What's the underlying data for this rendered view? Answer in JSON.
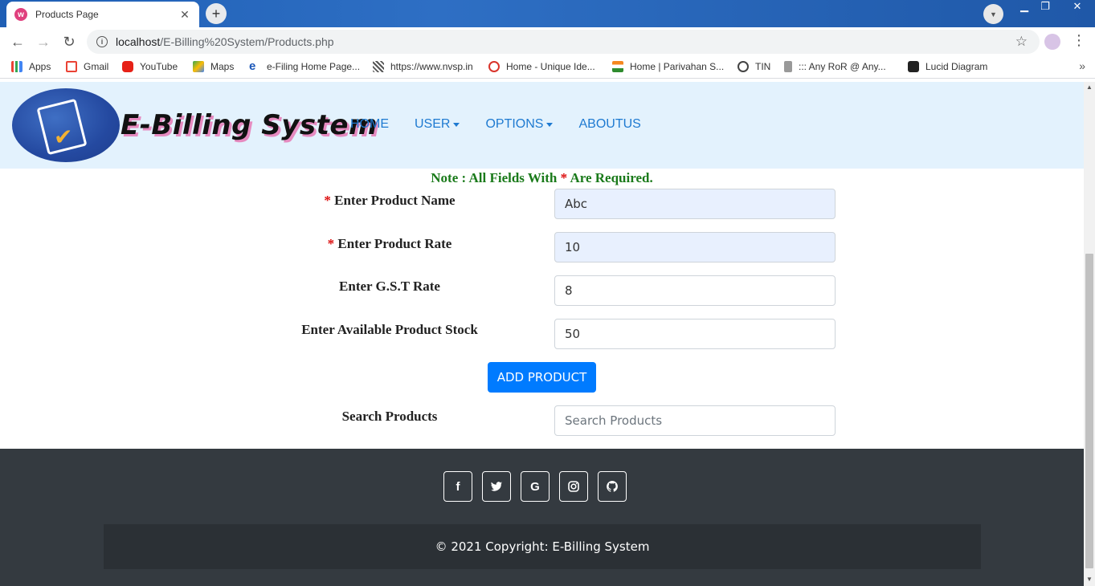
{
  "browser": {
    "tab_title": "Products Page",
    "tab_close": "✕",
    "new_tab": "+",
    "url_host": "localhost",
    "url_path": "/E-Billing%20System/Products.php",
    "bookmarks": [
      "Apps",
      "Gmail",
      "YouTube",
      "Maps",
      "e-Filing Home Page...",
      "https://www.nvsp.in",
      "Home - Unique Ide...",
      "Home | Parivahan S...",
      "TIN",
      "::: Any RoR @ Any...",
      "Lucid Diagram"
    ],
    "bookmarks_more": "»"
  },
  "navbar": {
    "brand": "E-Billing System",
    "links": [
      "HOME",
      "USER",
      "OPTIONS",
      "ABOUTUS"
    ]
  },
  "form": {
    "note_prefix": "Note : All Fields With ",
    "note_star": "*",
    "note_suffix": " Are Required.",
    "required_mark": "*",
    "fields": [
      {
        "label": "Enter Product Name",
        "value": "Abc",
        "required": true
      },
      {
        "label": "Enter Product Rate",
        "value": "10",
        "required": true
      },
      {
        "label": "Enter G.S.T Rate",
        "value": "8",
        "required": false
      },
      {
        "label": "Enter Available Product Stock",
        "value": "50",
        "required": false
      }
    ],
    "add_button": "ADD PRODUCT",
    "search_label": "Search Products",
    "search_placeholder": "Search Products"
  },
  "footer": {
    "socials": [
      "facebook-icon",
      "twitter-icon",
      "google-icon",
      "instagram-icon",
      "github-icon"
    ],
    "copyright": "© 2021 Copyright: E-Billing System"
  },
  "colors": {
    "navbar_bg": "#e3f2fd",
    "nav_link": "#1e7ad1",
    "note_green": "#1a7a1a",
    "required_red": "#dd1111",
    "button_blue": "#007bff",
    "footer_bg": "#343a40"
  }
}
